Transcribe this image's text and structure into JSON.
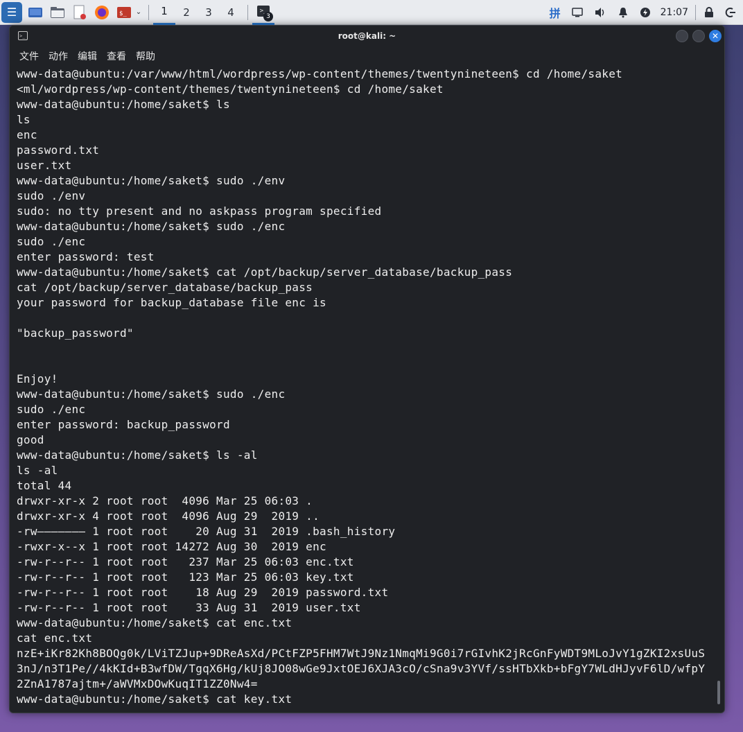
{
  "taskbar": {
    "workspaces": [
      "1",
      "2",
      "3",
      "4"
    ],
    "terminal_badge": "3",
    "input_method": "拼",
    "clock": "21:07"
  },
  "window": {
    "title": "root@kali: ~",
    "close_glyph": "✕"
  },
  "menu": [
    "文件",
    "动作",
    "编辑",
    "查看",
    "帮助"
  ],
  "terminal_lines": [
    "www-data@ubuntu:/var/www/html/wordpress/wp-content/themes/twentynineteen$ cd /home/saket",
    "<ml/wordpress/wp-content/themes/twentynineteen$ cd /home/saket",
    "www-data@ubuntu:/home/saket$ ls",
    "ls",
    "enc",
    "password.txt",
    "user.txt",
    "www-data@ubuntu:/home/saket$ sudo ./env",
    "sudo ./env",
    "sudo: no tty present and no askpass program specified",
    "www-data@ubuntu:/home/saket$ sudo ./enc",
    "sudo ./enc",
    "enter password: test",
    "www-data@ubuntu:/home/saket$ cat /opt/backup/server_database/backup_pass",
    "cat /opt/backup/server_database/backup_pass",
    "your password for backup_database file enc is",
    "",
    "\"backup_password\"",
    "",
    "",
    "Enjoy!",
    "www-data@ubuntu:/home/saket$ sudo ./enc",
    "sudo ./enc",
    "enter password: backup_password",
    "good",
    "www-data@ubuntu:/home/saket$ ls -al",
    "ls -al",
    "total 44",
    "drwxr-xr-x 2 root root  4096 Mar 25 06:03 .",
    "drwxr-xr-x 4 root root  4096 Aug 29  2019 ..",
    "-rw——————— 1 root root    20 Aug 31  2019 .bash_history",
    "-rwxr-x--x 1 root root 14272 Aug 30  2019 enc",
    "-rw-r--r-- 1 root root   237 Mar 25 06:03 enc.txt",
    "-rw-r--r-- 1 root root   123 Mar 25 06:03 key.txt",
    "-rw-r--r-- 1 root root    18 Aug 29  2019 password.txt",
    "-rw-r--r-- 1 root root    33 Aug 31  2019 user.txt",
    "www-data@ubuntu:/home/saket$ cat enc.txt",
    "cat enc.txt",
    "nzE+iKr82Kh8BOQg0k/LViTZJup+9DReAsXd/PCtFZP5FHM7WtJ9Nz1NmqMi9G0i7rGIvhK2jRcGnFyWDT9MLoJvY1gZKI2xsUuS",
    "3nJ/n3T1Pe//4kKId+B3wfDW/TgqX6Hg/kUj8JO08wGe9JxtOEJ6XJA3cO/cSna9v3YVf/ssHTbXkb+bFgY7WLdHJyvF6lD/wfpY",
    "2ZnA1787ajtm+/aWVMxDOwKuqIT1ZZ0Nw4=",
    "www-data@ubuntu:/home/saket$ cat key.txt"
  ]
}
